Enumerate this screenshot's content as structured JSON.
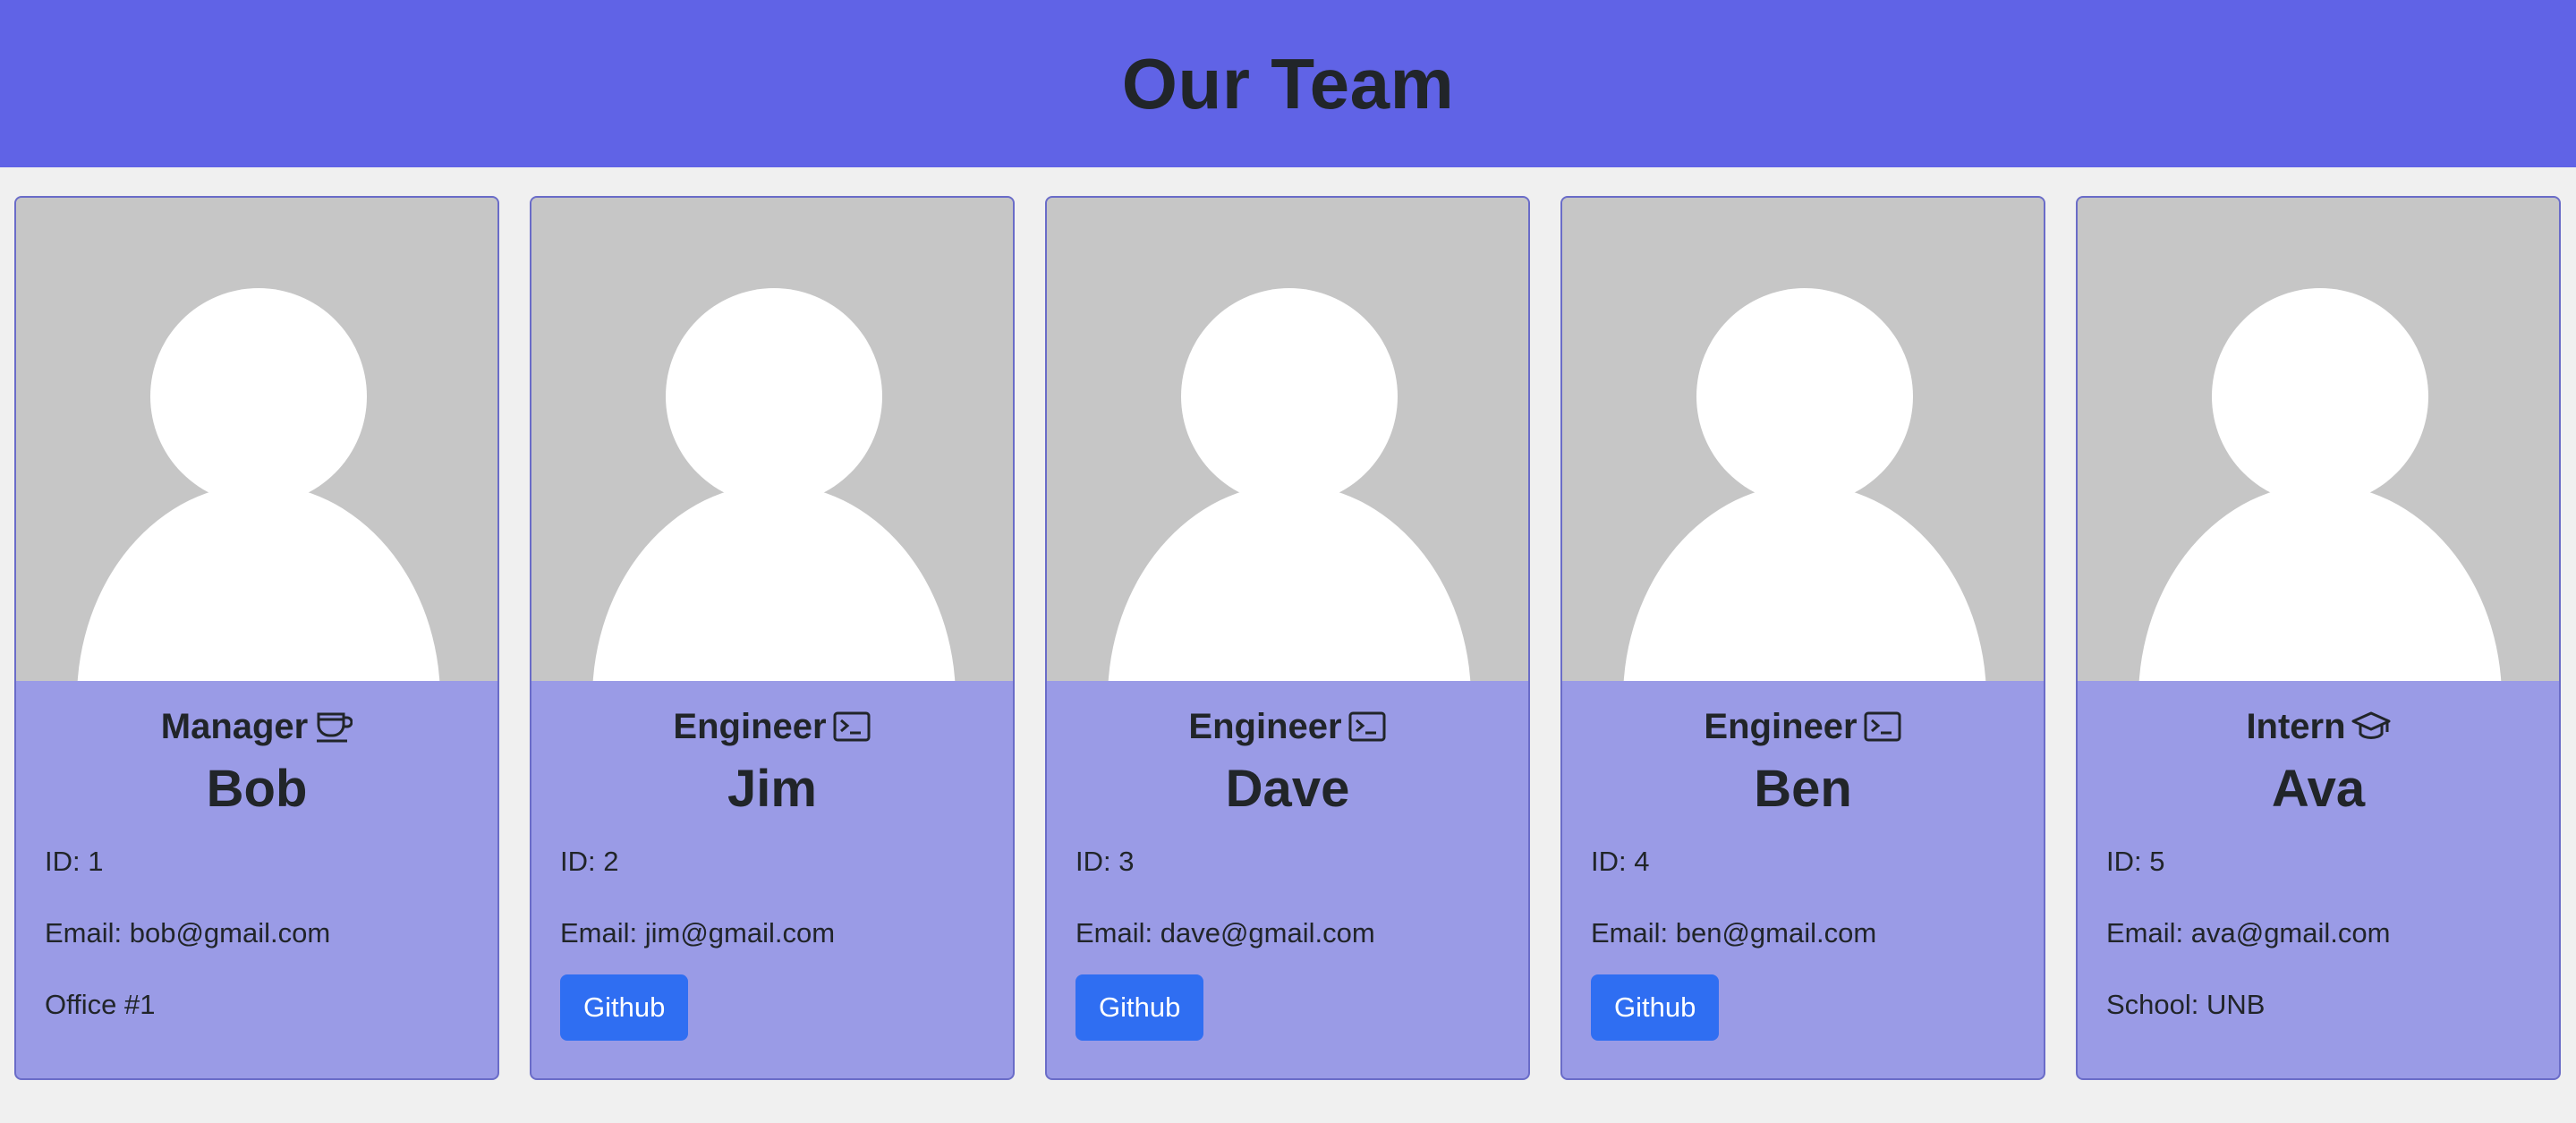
{
  "header": {
    "title": "Our Team"
  },
  "team": [
    {
      "role": "Manager",
      "role_icon": "coffee-cup-icon",
      "name": "Bob",
      "id_text": "ID: 1",
      "email_text": "Email: bob@gmail.com",
      "extra": "Office #1"
    },
    {
      "role": "Engineer",
      "role_icon": "terminal-icon",
      "name": "Jim",
      "id_text": "ID: 2",
      "email_text": "Email: jim@gmail.com",
      "github_label": "Github"
    },
    {
      "role": "Engineer",
      "role_icon": "terminal-icon",
      "name": "Dave",
      "id_text": "ID: 3",
      "email_text": "Email: dave@gmail.com",
      "github_label": "Github"
    },
    {
      "role": "Engineer",
      "role_icon": "terminal-icon",
      "name": "Ben",
      "id_text": "ID: 4",
      "email_text": "Email: ben@gmail.com",
      "github_label": "Github"
    },
    {
      "role": "Intern",
      "role_icon": "graduation-cap-icon",
      "name": "Ava",
      "id_text": "ID: 5",
      "email_text": "Email: ava@gmail.com",
      "extra": "School: UNB"
    }
  ],
  "colors": {
    "header_bg": "#6063e6",
    "card_body_bg": "#9a9be6",
    "photo_bg": "#c6c6c6",
    "button_bg": "#2f6ef2",
    "page_bg": "#f0f0f0"
  }
}
